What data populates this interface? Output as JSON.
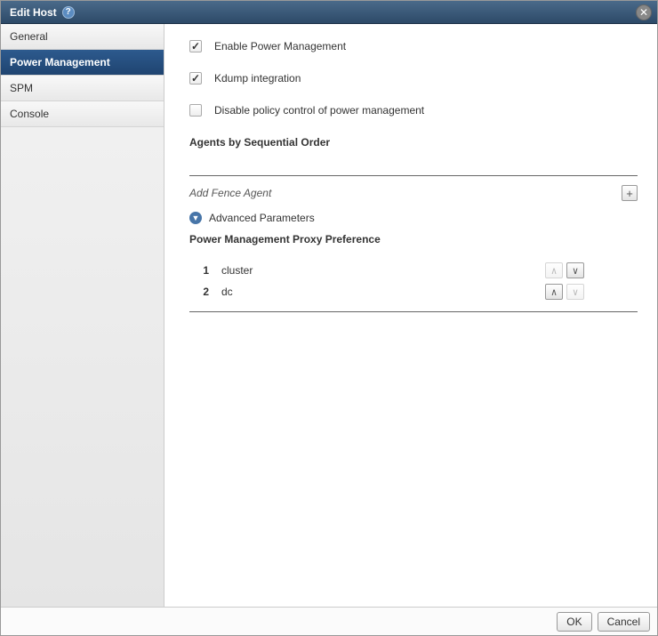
{
  "dialog": {
    "title": "Edit Host"
  },
  "sidebar": {
    "items": [
      {
        "label": "General",
        "selected": false
      },
      {
        "label": "Power Management",
        "selected": true
      },
      {
        "label": "SPM",
        "selected": false
      },
      {
        "label": "Console",
        "selected": false
      }
    ]
  },
  "content": {
    "enable_pm_label": "Enable Power Management",
    "enable_pm_checked": true,
    "kdump_label": "Kdump integration",
    "kdump_checked": true,
    "disable_policy_label": "Disable policy control of power management",
    "disable_policy_checked": false,
    "agents_heading": "Agents by Sequential Order",
    "add_fence_label": "Add Fence Agent",
    "advanced_label": "Advanced Parameters",
    "proxy_heading": "Power Management Proxy Preference",
    "proxy_rows": [
      {
        "idx": "1",
        "name": "cluster",
        "up_enabled": false,
        "down_enabled": true
      },
      {
        "idx": "2",
        "name": "dc",
        "up_enabled": true,
        "down_enabled": false
      }
    ]
  },
  "footer": {
    "ok": "OK",
    "cancel": "Cancel"
  },
  "glyphs": {
    "help": "?",
    "close": "✕",
    "plus": "+",
    "chevron_down": "▼",
    "up": "∧",
    "down": "∨"
  }
}
